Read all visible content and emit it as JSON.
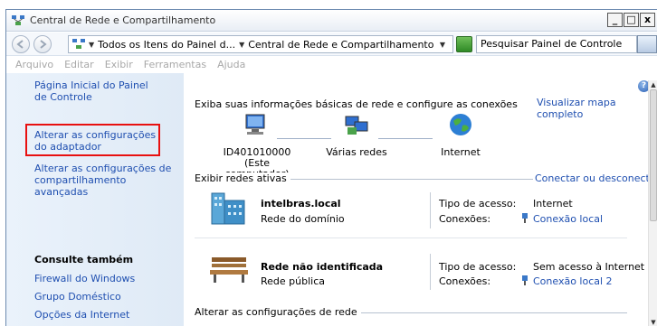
{
  "window": {
    "title": "Central de Rede e Compartilhamento",
    "controls": {
      "minimize": "_",
      "maximize": "□",
      "close": "x"
    }
  },
  "address": {
    "crumbs": [
      "Todos os Itens do Painel d...",
      "Central de Rede e Compartilhamento"
    ],
    "search_placeholder": "Pesquisar Painel de Controle"
  },
  "menu": [
    "Arquivo",
    "Editar",
    "Exibir",
    "Ferramentas",
    "Ajuda"
  ],
  "left_pane": {
    "home_link": "Página Inicial do Painel de Controle",
    "adapter_link": "Alterar as configurações do adaptador",
    "sharing_link": "Alterar as configurações de compartilhamento avançadas",
    "see_also_title": "Consulte também",
    "see_also": [
      "Firewall do Windows",
      "Grupo Doméstico",
      "Opções da Internet"
    ]
  },
  "main": {
    "help": "?",
    "header": "Exiba suas informações básicas de rede e configure as conexões",
    "map_link": "Visualizar mapa completo",
    "nodes": {
      "computer": "ID401010000",
      "computer_sub": "(Este computador)",
      "networks": "Várias redes",
      "internet": "Internet"
    },
    "active_label": "Exibir redes ativas",
    "connect_link": "Conectar ou desconectar",
    "networks": [
      {
        "name": "intelbras.local",
        "type": "Rede do domínio",
        "access_label": "Tipo de acesso:",
        "access_value": "Internet",
        "conn_label": "Conexões:",
        "conn_value": "Conexão local"
      },
      {
        "name": "Rede não identificada",
        "type": "Rede pública",
        "access_label": "Tipo de acesso:",
        "access_value": "Sem acesso à Internet",
        "conn_label": "Conexões:",
        "conn_value": "Conexão local 2"
      }
    ],
    "change_label": "Alterar as configurações de rede"
  },
  "colors": {
    "link": "#1f4fb0",
    "highlight": "#e81010"
  }
}
